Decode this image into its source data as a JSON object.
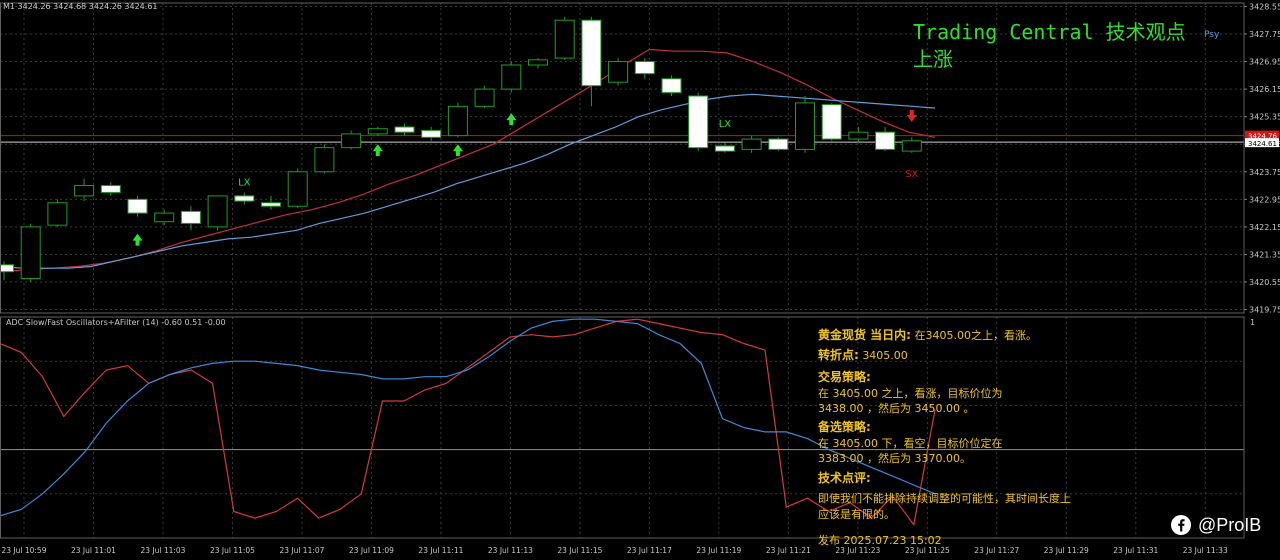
{
  "header": {
    "symbol_line": "M1  3424.26 3424.68 3424.26 3424.61",
    "psy_label": "Psy",
    "indicator_line": "ADC Slow/Fast Oscillators+AFilter (14) -0.60 0.51 -0.00"
  },
  "overlay": {
    "title": "Trading Central 技术观点",
    "direction": "上涨",
    "lines": [
      {
        "label": "黄金现货 当日内:",
        "text": "在3405.00之上，看涨。"
      },
      {
        "label": "转折点:",
        "text": "3405.00"
      },
      {
        "label": "交易策略:",
        "text": ""
      },
      {
        "label": "",
        "text": "在 3405.00 之上，看涨，目标价位为"
      },
      {
        "label": "",
        "text": "3438.00 ，然后为 3450.00 。"
      },
      {
        "label": "备选策略:",
        "text": ""
      },
      {
        "label": "",
        "text": "在 3405.00 下，看空，目标价位定在"
      },
      {
        "label": "",
        "text": "3383.00 ，然后为 3370.00。"
      },
      {
        "label": "技术点评:",
        "text": ""
      },
      {
        "label": "",
        "text": "即使我们不能排除持续调整的可能性，其时间长度上"
      },
      {
        "label": "",
        "text": "应该是有限的。"
      },
      {
        "label": "",
        "text": "发布  2025.07.23 15:02"
      }
    ],
    "brand": "@ProIB"
  },
  "colors": {
    "background": "#000000",
    "grid": "#3a3a3a",
    "bull": "#1f9e1f",
    "bear": "#ffffff",
    "ma_fast": "#c0303a",
    "ma_slow": "#5aa0d8",
    "osc_red": "#d43a3a",
    "osc_blue": "#3a8ad8",
    "osc_zero": "#b8923a",
    "hline_red": "#c01818",
    "hline_white": "#cfcfcf",
    "arrow_up": "#2ee02e",
    "arrow_down": "#e02424",
    "lx": "#2ee02e",
    "sx": "#c01818",
    "text": "#c8c8c8",
    "price_label": "#d01818"
  },
  "chart_data": {
    "type": "candlestick",
    "price_axis": {
      "ticks": [
        "3428.55",
        "3427.75",
        "3426.95",
        "3426.15",
        "3425.35",
        "3424.55",
        "3423.75",
        "3422.95",
        "3422.15",
        "3421.35",
        "3420.55",
        "3419.75"
      ],
      "current_label": "3424.61",
      "red_line_label": "3424.76",
      "ylim": [
        3419.65,
        3428.65
      ]
    },
    "time_labels": [
      "23 Jul 10:59",
      "23 Jul 11:01",
      "23 Jul 11:03",
      "23 Jul 11:05",
      "23 Jul 11:07",
      "23 Jul 11:09",
      "23 Jul 11:11",
      "23 Jul 11:13",
      "23 Jul 11:15",
      "23 Jul 11:17",
      "23 Jul 11:19",
      "23 Jul 11:21",
      "23 Jul 11:23",
      "23 Jul 11:25",
      "23 Jul 11:27",
      "23 Jul 11:29",
      "23 Jul 11:31",
      "23 Jul 11:33"
    ],
    "candles": [
      {
        "o": 3421.05,
        "h": 3421.15,
        "l": 3420.6,
        "c": 3420.85
      },
      {
        "o": 3420.65,
        "h": 3422.25,
        "l": 3420.55,
        "c": 3422.15
      },
      {
        "o": 3422.2,
        "h": 3422.95,
        "l": 3422.15,
        "c": 3422.85
      },
      {
        "o": 3423.05,
        "h": 3423.55,
        "l": 3422.9,
        "c": 3423.35
      },
      {
        "o": 3423.35,
        "h": 3423.45,
        "l": 3423.05,
        "c": 3423.15
      },
      {
        "o": 3422.95,
        "h": 3423.05,
        "l": 3422.45,
        "c": 3422.55
      },
      {
        "o": 3422.3,
        "h": 3422.65,
        "l": 3422.2,
        "c": 3422.55
      },
      {
        "o": 3422.6,
        "h": 3422.75,
        "l": 3422.05,
        "c": 3422.25
      },
      {
        "o": 3422.15,
        "h": 3423.05,
        "l": 3422.05,
        "c": 3423.05
      },
      {
        "o": 3423.05,
        "h": 3423.15,
        "l": 3422.8,
        "c": 3422.9
      },
      {
        "o": 3422.85,
        "h": 3423.05,
        "l": 3422.65,
        "c": 3422.75
      },
      {
        "o": 3422.75,
        "h": 3423.85,
        "l": 3422.7,
        "c": 3423.75
      },
      {
        "o": 3423.75,
        "h": 3424.55,
        "l": 3423.7,
        "c": 3424.45
      },
      {
        "o": 3424.45,
        "h": 3424.95,
        "l": 3424.4,
        "c": 3424.85
      },
      {
        "o": 3424.85,
        "h": 3425.05,
        "l": 3424.8,
        "c": 3425.0
      },
      {
        "o": 3425.05,
        "h": 3425.15,
        "l": 3424.8,
        "c": 3424.9
      },
      {
        "o": 3424.95,
        "h": 3425.05,
        "l": 3424.65,
        "c": 3424.75
      },
      {
        "o": 3424.8,
        "h": 3425.75,
        "l": 3424.75,
        "c": 3425.65
      },
      {
        "o": 3425.65,
        "h": 3426.25,
        "l": 3425.6,
        "c": 3426.15
      },
      {
        "o": 3426.15,
        "h": 3426.95,
        "l": 3426.05,
        "c": 3426.85
      },
      {
        "o": 3426.85,
        "h": 3427.05,
        "l": 3426.75,
        "c": 3427.0
      },
      {
        "o": 3427.05,
        "h": 3428.25,
        "l": 3427.0,
        "c": 3428.15
      },
      {
        "o": 3428.15,
        "h": 3428.25,
        "l": 3425.65,
        "c": 3426.25
      },
      {
        "o": 3426.35,
        "h": 3427.05,
        "l": 3426.25,
        "c": 3426.95
      },
      {
        "o": 3426.95,
        "h": 3427.05,
        "l": 3426.45,
        "c": 3426.6
      },
      {
        "o": 3426.45,
        "h": 3426.55,
        "l": 3425.95,
        "c": 3426.05
      },
      {
        "o": 3425.95,
        "h": 3426.05,
        "l": 3424.35,
        "c": 3424.45
      },
      {
        "o": 3424.5,
        "h": 3424.6,
        "l": 3424.3,
        "c": 3424.35
      },
      {
        "o": 3424.4,
        "h": 3424.8,
        "l": 3424.3,
        "c": 3424.7
      },
      {
        "o": 3424.7,
        "h": 3424.75,
        "l": 3424.35,
        "c": 3424.4
      },
      {
        "o": 3424.4,
        "h": 3425.95,
        "l": 3424.3,
        "c": 3425.75
      },
      {
        "o": 3425.7,
        "h": 3425.75,
        "l": 3424.65,
        "c": 3424.7
      },
      {
        "o": 3424.7,
        "h": 3425.05,
        "l": 3424.6,
        "c": 3424.9
      },
      {
        "o": 3424.9,
        "h": 3425.05,
        "l": 3424.35,
        "c": 3424.4
      },
      {
        "o": 3424.35,
        "h": 3424.75,
        "l": 3424.3,
        "c": 3424.65
      }
    ],
    "ma_fast": [
      3420.85,
      3420.9,
      3420.95,
      3421.0,
      3421.1,
      3421.25,
      3421.45,
      3421.7,
      3421.9,
      3422.1,
      3422.3,
      3422.5,
      3422.65,
      3422.85,
      3423.1,
      3423.4,
      3423.65,
      3423.95,
      3424.25,
      3424.55,
      3425.0,
      3425.45,
      3425.9,
      3426.35,
      3426.85,
      3427.3,
      3427.25,
      3427.25,
      3427.2,
      3426.95,
      3426.65,
      3426.3,
      3425.9,
      3425.55,
      3425.2,
      3424.9,
      3424.75
    ],
    "ma_slow": [
      3421.0,
      3420.95,
      3420.95,
      3420.95,
      3421.0,
      3421.15,
      3421.3,
      3421.45,
      3421.6,
      3421.7,
      3421.8,
      3421.85,
      3421.95,
      3422.05,
      3422.25,
      3422.4,
      3422.55,
      3422.75,
      3422.95,
      3423.15,
      3423.4,
      3423.6,
      3423.8,
      3424.0,
      3424.25,
      3424.55,
      3424.8,
      3425.05,
      3425.35,
      3425.55,
      3425.7,
      3425.85,
      3425.95,
      3426.0,
      3425.95,
      3425.9,
      3425.85,
      3425.8,
      3425.75,
      3425.7,
      3425.65,
      3425.6
    ],
    "hline_red": 3424.8,
    "hline_white": 3424.61,
    "signals": [
      {
        "type": "up_arrow",
        "idx": 5,
        "price": 3421.75
      },
      {
        "type": "lx",
        "idx": 9,
        "price": 3423.35,
        "text": "LX"
      },
      {
        "type": "up_arrow",
        "idx": 14,
        "price": 3424.35
      },
      {
        "type": "up_arrow",
        "idx": 17,
        "price": 3424.35
      },
      {
        "type": "up_arrow",
        "idx": 19,
        "price": 3425.25
      },
      {
        "type": "lx",
        "idx": 27,
        "price": 3425.05,
        "text": "LX"
      },
      {
        "type": "down_arrow",
        "idx": 34,
        "price": 3425.4
      },
      {
        "type": "sx",
        "idx": 34,
        "price": 3423.6,
        "text": "SX"
      }
    ],
    "oscillator": {
      "red": [
        0.88,
        0.84,
        0.73,
        0.55,
        0.66,
        0.76,
        0.78,
        0.7,
        0.74,
        0.76,
        0.7,
        0.12,
        0.09,
        0.12,
        0.18,
        0.09,
        0.13,
        0.2,
        0.62,
        0.62,
        0.67,
        0.7,
        0.77,
        0.84,
        0.91,
        0.92,
        0.91,
        0.92,
        0.95,
        0.98,
        0.99,
        0.97,
        0.95,
        0.93,
        0.92,
        0.88,
        0.85,
        0.14,
        0.18,
        0.12,
        0.16,
        0.09,
        0.19,
        0.06,
        0.58
      ],
      "blue": [
        0.1,
        0.13,
        0.2,
        0.29,
        0.39,
        0.52,
        0.62,
        0.7,
        0.74,
        0.77,
        0.79,
        0.8,
        0.8,
        0.79,
        0.78,
        0.76,
        0.75,
        0.74,
        0.72,
        0.72,
        0.73,
        0.73,
        0.76,
        0.82,
        0.89,
        0.95,
        0.98,
        0.99,
        0.99,
        0.98,
        0.97,
        0.92,
        0.88,
        0.79,
        0.54,
        0.5,
        0.48,
        0.48,
        0.45,
        0.4,
        0.36,
        0.32,
        0.28,
        0.24,
        0.2
      ],
      "zero_level": 0.4
    }
  }
}
